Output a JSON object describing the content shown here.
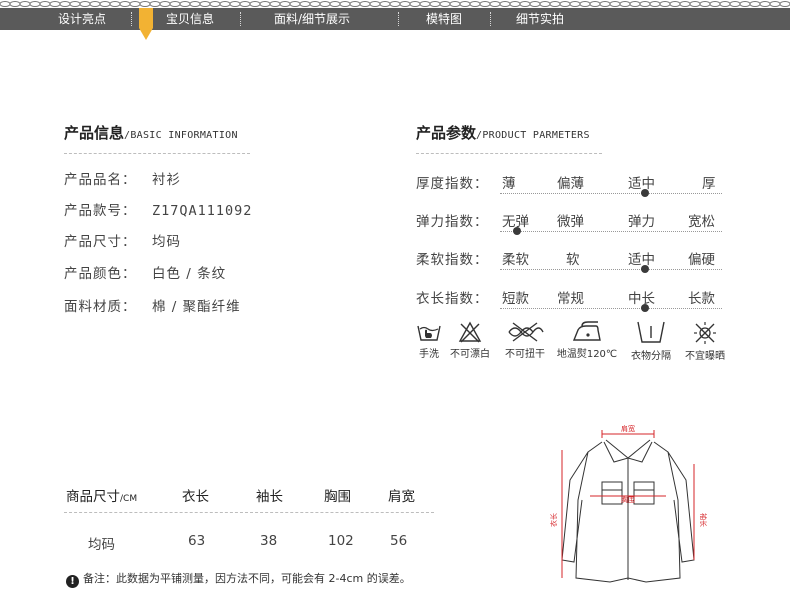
{
  "nav": {
    "items": [
      "设计亮点",
      "宝贝信息",
      "面料/细节展示",
      "模特图",
      "细节实拍"
    ],
    "active_index": 1,
    "accent_color": "#f2b233",
    "bar_color": "#5a5a5a"
  },
  "product_info": {
    "title": "产品信息",
    "subtitle": "/BASIC INFORMATION",
    "rows": [
      {
        "label": "产品品名：",
        "value": "衬衫"
      },
      {
        "label": "产品款号：",
        "value": "Z17QA111092"
      },
      {
        "label": "产品尺寸：",
        "value": "均码"
      },
      {
        "label": "产品颜色：",
        "value": "白色 / 条纹"
      },
      {
        "label": "面料材质：",
        "value": "棉 / 聚酯纤维"
      }
    ]
  },
  "product_params": {
    "title": "产品参数",
    "subtitle": "/PRODUCT PARMETERS",
    "rows": [
      {
        "label": "厚度指数：",
        "options": [
          "薄",
          "偏薄",
          "适中",
          "厚"
        ],
        "selected": 2
      },
      {
        "label": "弹力指数：",
        "options": [
          "无弹",
          "微弹",
          "弹力",
          "宽松"
        ],
        "selected": 0
      },
      {
        "label": "柔软指数：",
        "options": [
          "柔软",
          "软",
          "适中",
          "偏硬"
        ],
        "selected": 2
      },
      {
        "label": "衣长指数：",
        "options": [
          "短款",
          "常规",
          "中长",
          "长款"
        ],
        "selected": 2
      }
    ]
  },
  "care": [
    {
      "icon": "hand-wash-icon",
      "label": "手洗"
    },
    {
      "icon": "no-bleach-icon",
      "label": "不可漂白"
    },
    {
      "icon": "no-wring-icon",
      "label": "不可扭干"
    },
    {
      "icon": "low-iron-icon",
      "label": "地温熨120℃"
    },
    {
      "icon": "separate-wash-icon",
      "label": "衣物分隔"
    },
    {
      "icon": "no-sun-dry-icon",
      "label": "不宜曝晒"
    }
  ],
  "size_table": {
    "header_label": "商品尺寸",
    "header_unit": "/CM",
    "columns": [
      "衣长",
      "袖长",
      "胸围",
      "肩宽"
    ],
    "row_label": "均码",
    "values": [
      "63",
      "38",
      "102",
      "56"
    ]
  },
  "note": {
    "icon": "exclamation-icon",
    "text": "备注：此数据为平铺测量，因方法不同，可能会有 2-4cm 的误差。"
  },
  "diagram": {
    "labels": {
      "shoulder": "肩宽",
      "chest": "胸围",
      "length": "衣长",
      "sleeve": "袖长"
    },
    "measure_color": "#d6262a"
  }
}
